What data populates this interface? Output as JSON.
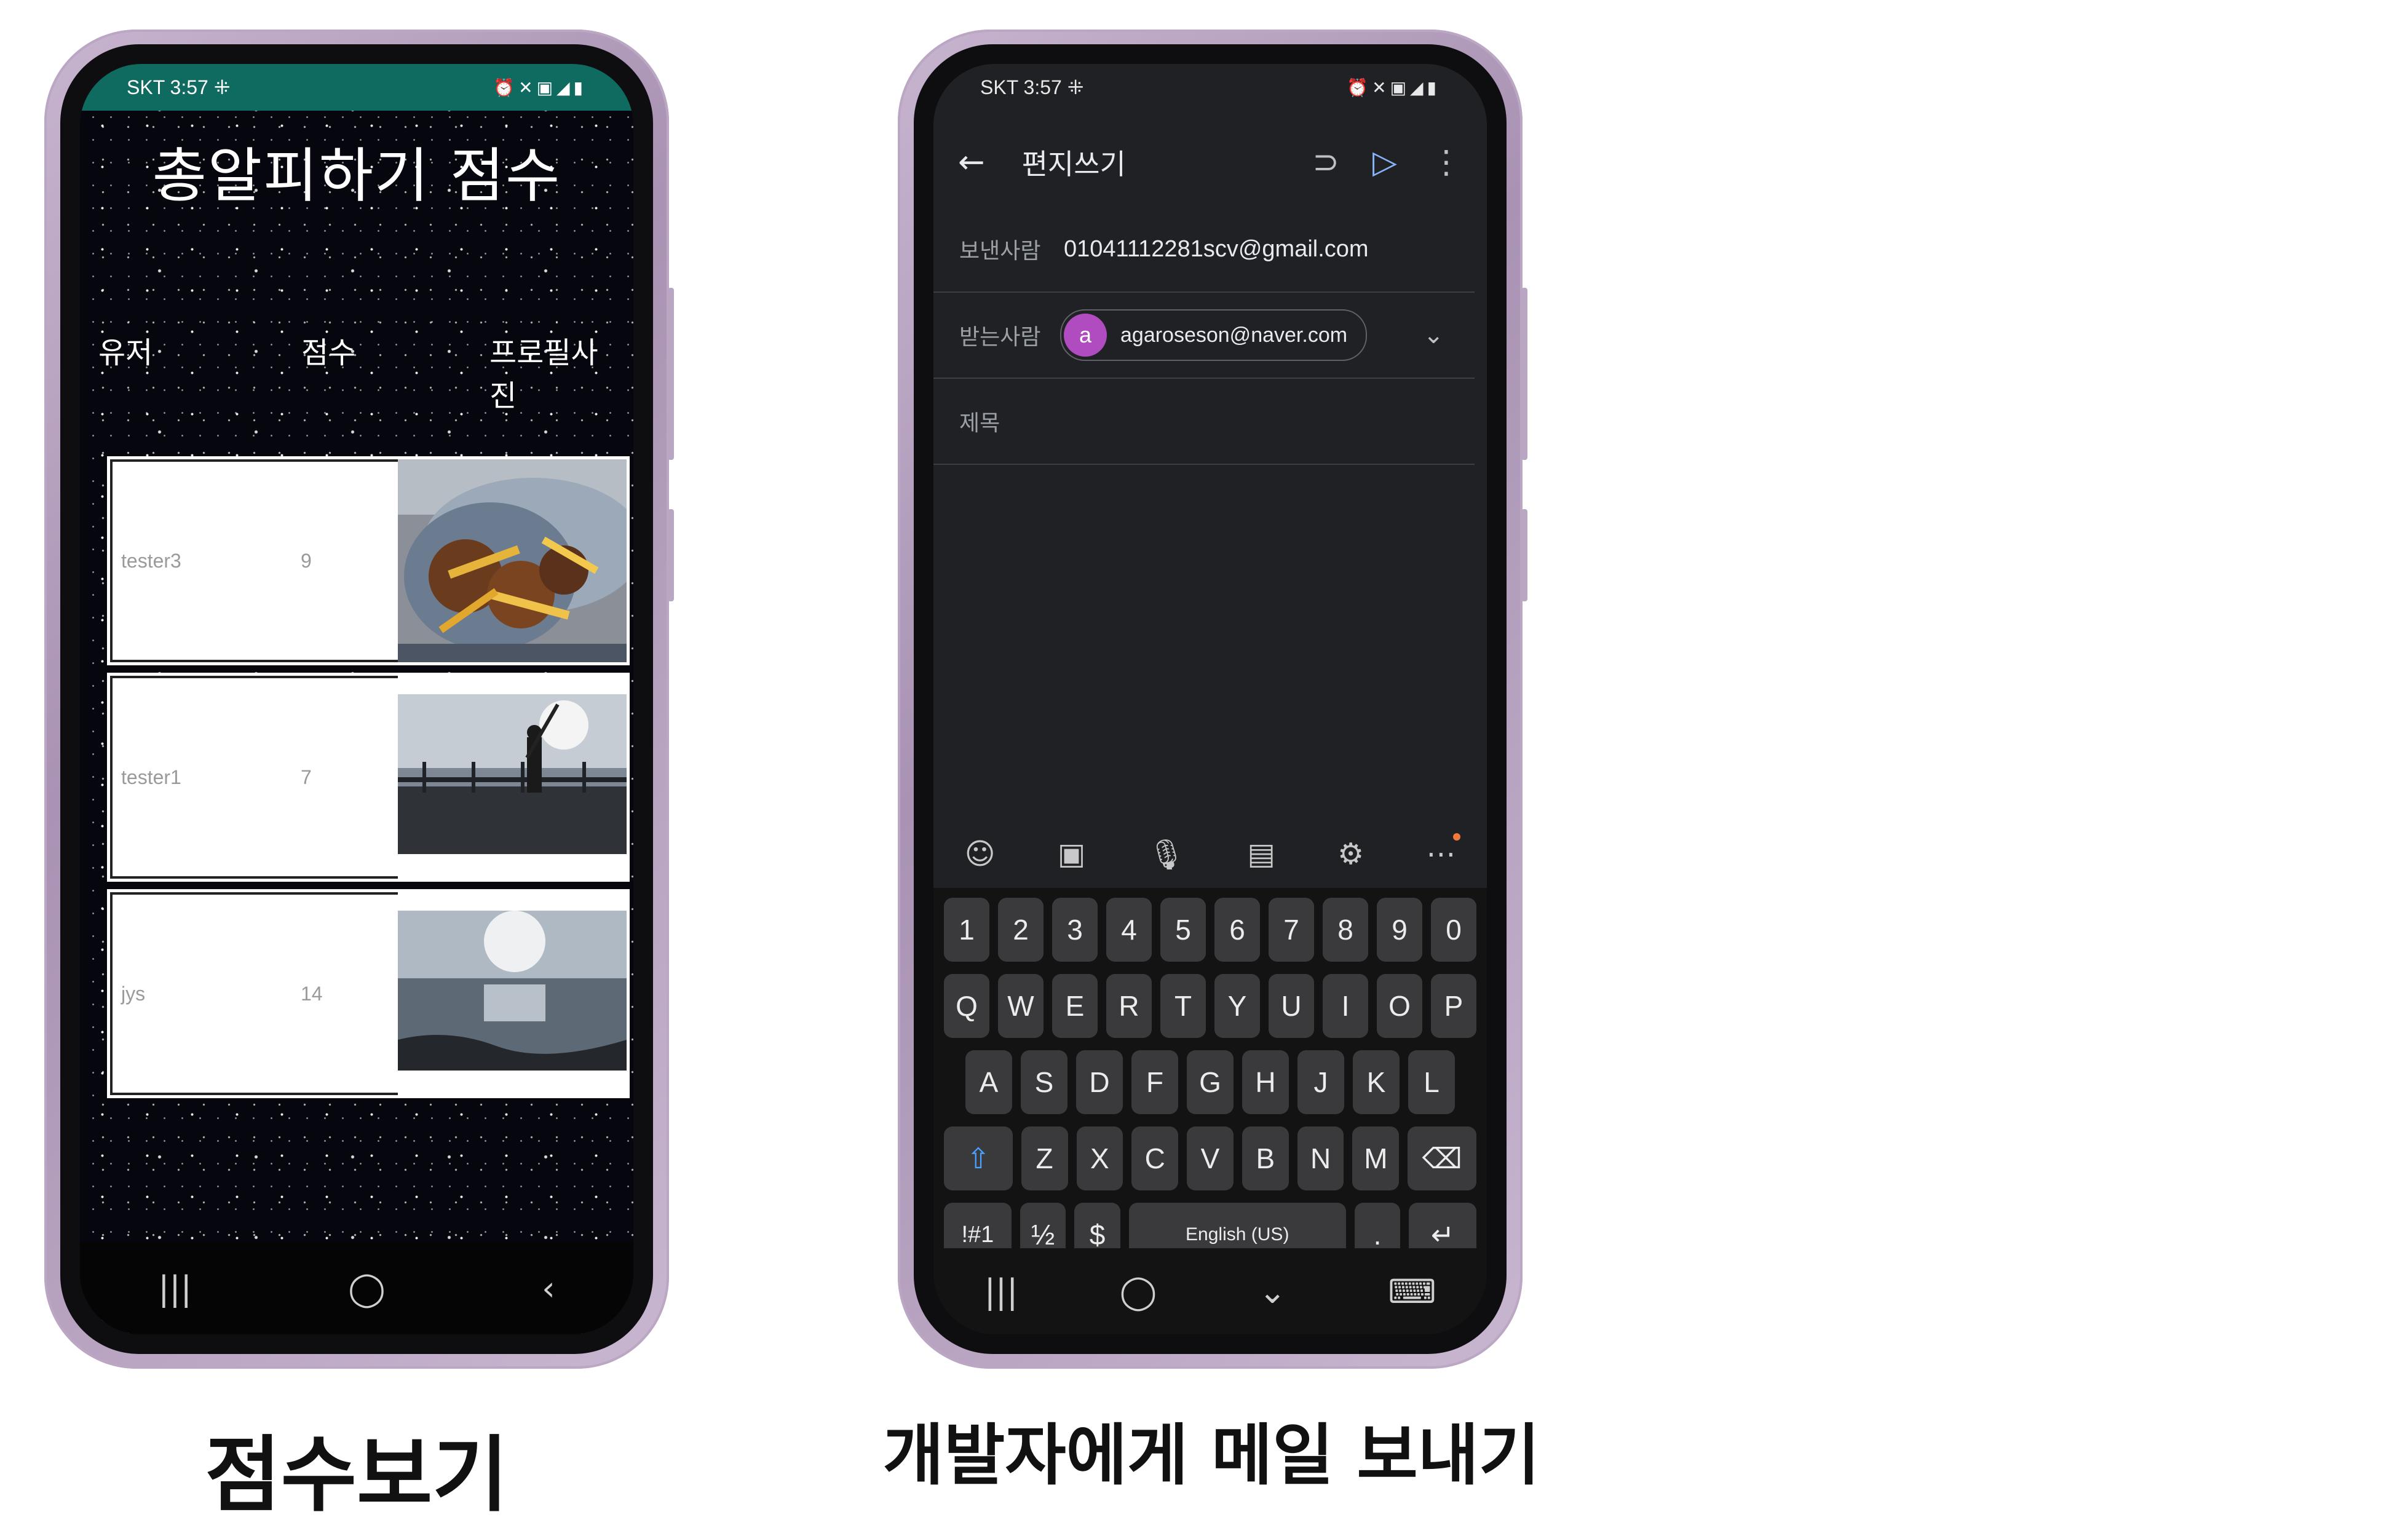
{
  "phone1": {
    "status": {
      "carrier_time": "SKT 3:57 ⁜",
      "icons": "⏰✕▣◢▮"
    },
    "title": "총알피하기 점수",
    "headers": {
      "user": "유저",
      "score": "점수",
      "photo": "프로필사진"
    },
    "rows": [
      {
        "user": "tester3",
        "score": "9",
        "photo": "food"
      },
      {
        "user": "tester1",
        "score": "7",
        "photo": "pier"
      },
      {
        "user": "jys",
        "score": "14",
        "photo": "sea"
      }
    ],
    "nav": {
      "recent": "|||",
      "home": "◯",
      "back": "‹"
    }
  },
  "phone2": {
    "status": {
      "carrier_time": "SKT 3:57 ⁜",
      "icons": "⏰✕▣◢▮"
    },
    "appbar": {
      "back_icon": "←",
      "title": "편지쓰기",
      "attach_icon": "⊃",
      "send_icon": "▷",
      "more_icon": "⋮"
    },
    "from": {
      "label": "보낸사람",
      "value": "01041112281scv@gmail.com"
    },
    "to": {
      "label": "받는사람",
      "avatar": "a",
      "value": "agaroseson@naver.com",
      "expand_icon": "⌄"
    },
    "subject": {
      "placeholder": "제목"
    },
    "toolbar": [
      "☺",
      "▣",
      "🎙",
      "▤",
      "⚙",
      "⋯"
    ],
    "keyboard": {
      "row1": [
        "1",
        "2",
        "3",
        "4",
        "5",
        "6",
        "7",
        "8",
        "9",
        "0"
      ],
      "row2": [
        "Q",
        "W",
        "E",
        "R",
        "T",
        "Y",
        "U",
        "I",
        "O",
        "P"
      ],
      "row3": [
        "A",
        "S",
        "D",
        "F",
        "G",
        "H",
        "J",
        "K",
        "L"
      ],
      "row4_shift": "⇧",
      "row4": [
        "Z",
        "X",
        "C",
        "V",
        "B",
        "N",
        "M"
      ],
      "row4_backspace": "⌫",
      "row5": {
        "symbols": "!#1",
        "fraction": "½",
        "dollar": "$",
        "space": "English (US)",
        "period": ".",
        "enter": "↵"
      }
    },
    "nav": {
      "recent": "|||",
      "home": "◯",
      "hide": "⌄",
      "keyboard": "⌨"
    }
  },
  "captions": {
    "left": "점수보기",
    "right": "개발자에게 메일 보내기"
  }
}
